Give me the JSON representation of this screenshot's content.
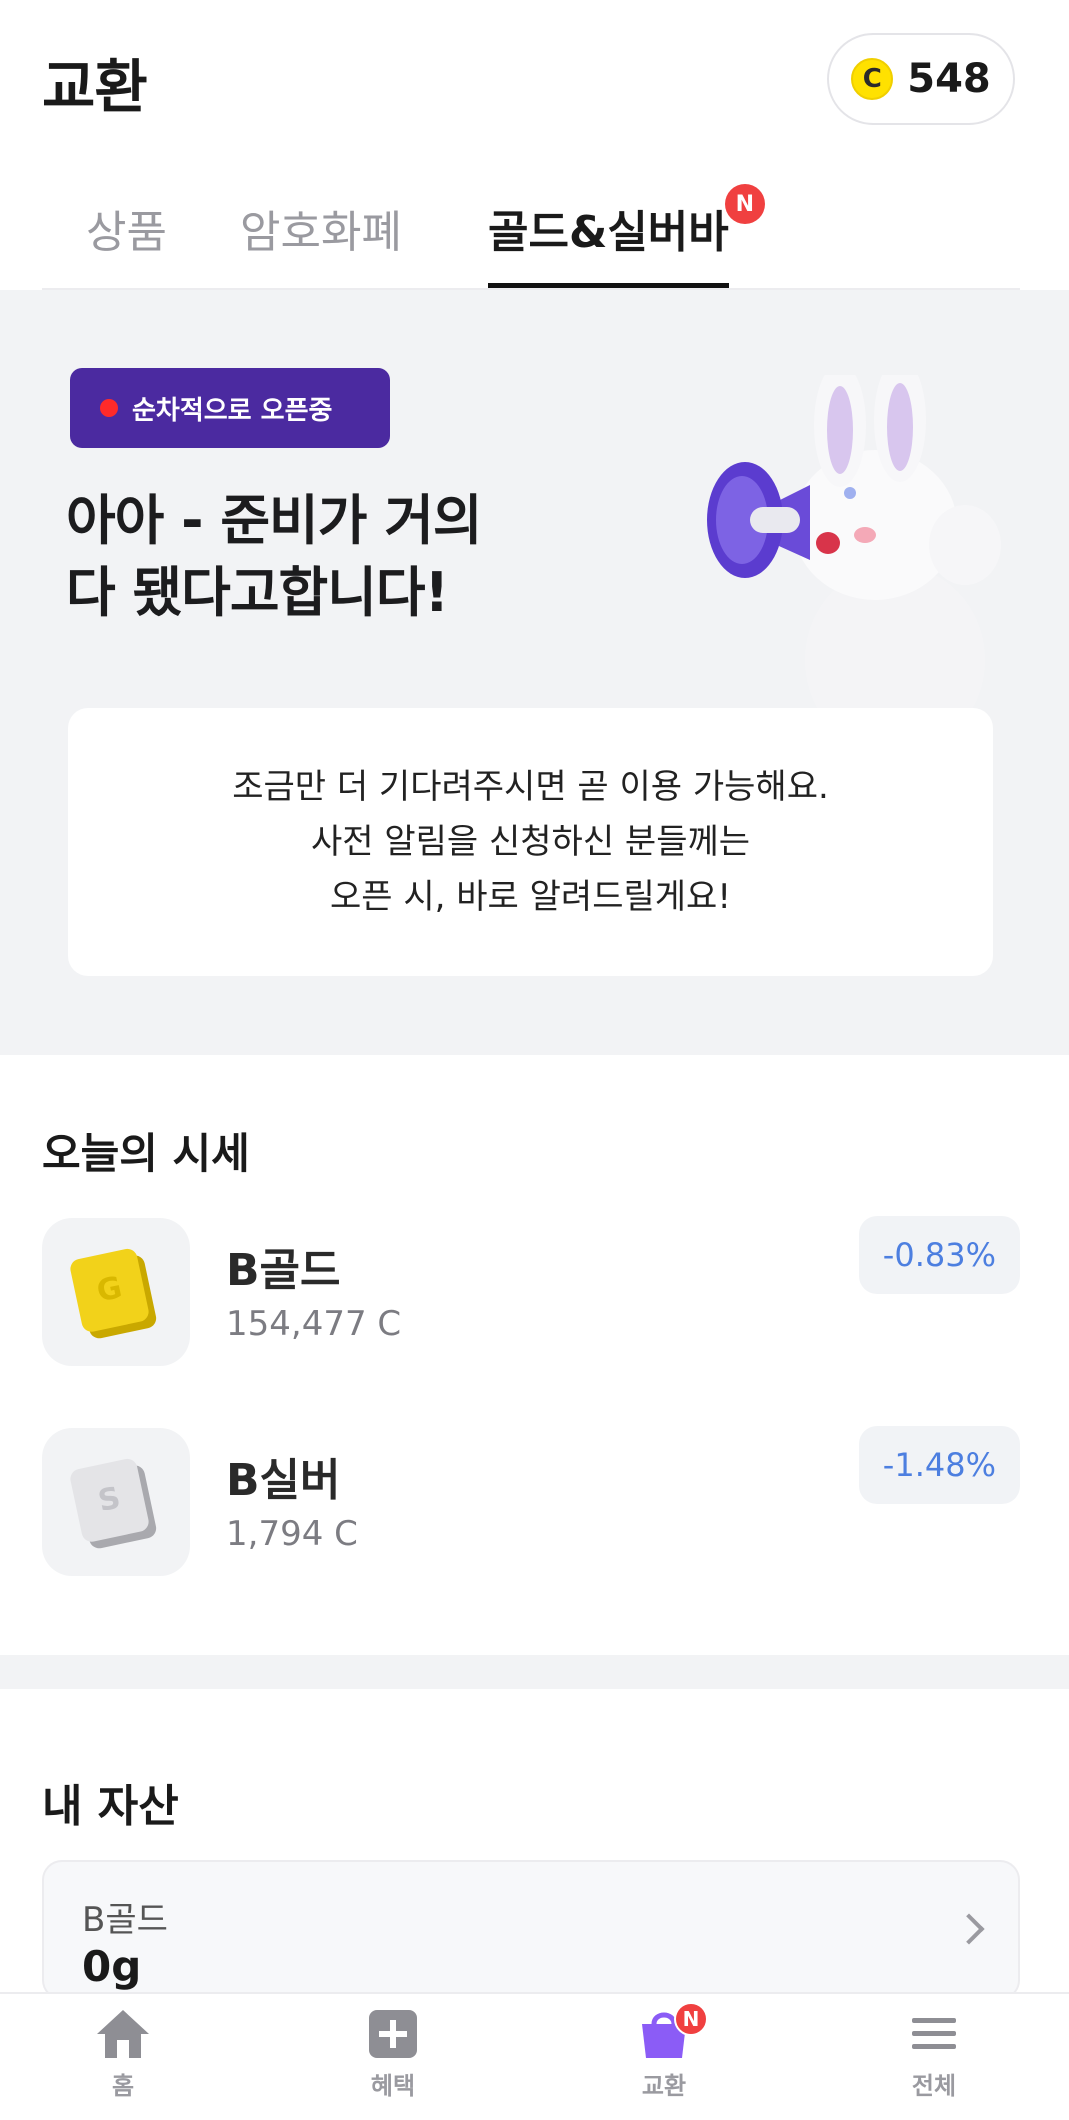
{
  "header": {
    "title": "교환",
    "coin_symbol": "C",
    "coin_balance": "548"
  },
  "tabs": [
    {
      "label": "상품",
      "active": false
    },
    {
      "label": "암호화폐",
      "active": false
    },
    {
      "label": "골드&실버바",
      "active": true,
      "badge": "N"
    }
  ],
  "promo": {
    "badge": "순차적으로 오픈중",
    "headline_line1": "아아 - 준비가 거의",
    "headline_line2": "다 됐다고합니다!",
    "message_line1": "조금만 더 기다려주시면 곧 이용 가능해요.",
    "message_line2": "사전 알림을 신청하신 분들께는",
    "message_line3": "오픈 시, 바로 알려드릴게요!"
  },
  "prices": {
    "title": "오늘의 시세",
    "items": [
      {
        "name": "B골드",
        "price": "154,477 C",
        "change": "-0.83%",
        "icon": "gold-bar-icon",
        "letter": "G"
      },
      {
        "name": "B실버",
        "price": "1,794 C",
        "change": "-1.48%",
        "icon": "silver-bar-icon",
        "letter": "S"
      }
    ]
  },
  "my_assets": {
    "title": "내 자산",
    "card_label": "B골드",
    "card_value": "0g"
  },
  "bottom_nav": [
    {
      "label": "홈",
      "icon": "home-icon"
    },
    {
      "label": "혜택",
      "icon": "plus-square-icon"
    },
    {
      "label": "교환",
      "icon": "shopping-bag-icon",
      "active": true,
      "badge": "N"
    },
    {
      "label": "전체",
      "icon": "menu-icon"
    }
  ],
  "colors": {
    "accent": "#8b5cf6",
    "badge_purple": "#4b2aa0",
    "negative_change": "#4d7fe0",
    "notice_red": "#f04040",
    "coin_yellow": "#ffe100"
  }
}
